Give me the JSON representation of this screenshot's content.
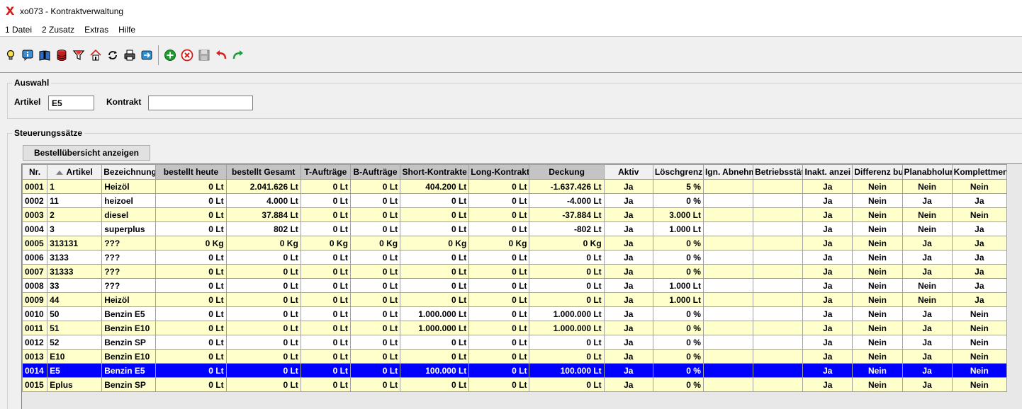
{
  "window": {
    "title": "xo073 - Kontraktverwaltung",
    "accent": "#d61a1a"
  },
  "menu": [
    "1 Datei",
    "2 Zusatz",
    "Extras",
    "Hilfe"
  ],
  "toolbar_icons": [
    "info-bulb-icon",
    "info-icon",
    "book-icon",
    "database-icon",
    "filter-icon",
    "home-icon",
    "refresh-icon",
    "print-icon",
    "mail-icon",
    "add-icon",
    "delete-icon",
    "save-icon",
    "undo-icon",
    "redo-icon"
  ],
  "auswahl": {
    "legend": "Auswahl",
    "artikel_label": "Artikel",
    "artikel_value": "E5",
    "kontrakt_label": "Kontrakt",
    "kontrakt_value": ""
  },
  "steuerung": {
    "legend": "Steuerungssätze",
    "button_label": "Bestellübersicht anzeigen"
  },
  "table": {
    "columns": [
      "Nr.",
      "Artikel",
      "Bezeichnung",
      "bestellt heute",
      "bestellt Gesamt",
      "T-Aufträge",
      "B-Aufträge",
      "Short-Kontrakte",
      "Long-Kontrakt",
      "Deckung",
      "Aktiv",
      "Löschgrenz",
      "Ign. Abnehm",
      "Betriebsstät",
      "Inakt. anzei",
      "Differenz bu",
      "Planabholur",
      "Komplettmen"
    ],
    "selected_color": "#0000ff",
    "rows": [
      [
        "0001",
        "1",
        "Heizöl",
        "0 Lt",
        "2.041.626 Lt",
        "0 Lt",
        "0 Lt",
        "404.200 Lt",
        "0 Lt",
        "-1.637.426 Lt",
        "Ja",
        "5 %",
        "",
        "",
        "Ja",
        "Nein",
        "Nein",
        "Nein"
      ],
      [
        "0002",
        "11",
        "heizoel",
        "0 Lt",
        "4.000 Lt",
        "0 Lt",
        "0 Lt",
        "0 Lt",
        "0 Lt",
        "-4.000 Lt",
        "Ja",
        "0 %",
        "",
        "",
        "Ja",
        "Nein",
        "Ja",
        "Ja"
      ],
      [
        "0003",
        "2",
        "diesel",
        "0 Lt",
        "37.884 Lt",
        "0 Lt",
        "0 Lt",
        "0 Lt",
        "0 Lt",
        "-37.884 Lt",
        "Ja",
        "3.000 Lt",
        "",
        "",
        "Ja",
        "Nein",
        "Nein",
        "Nein"
      ],
      [
        "0004",
        "3",
        "superplus",
        "0 Lt",
        "802 Lt",
        "0 Lt",
        "0 Lt",
        "0 Lt",
        "0 Lt",
        "-802 Lt",
        "Ja",
        "1.000 Lt",
        "",
        "",
        "Ja",
        "Nein",
        "Nein",
        "Ja"
      ],
      [
        "0005",
        "313131",
        "???",
        "0 Kg",
        "0 Kg",
        "0 Kg",
        "0 Kg",
        "0 Kg",
        "0 Kg",
        "0 Kg",
        "Ja",
        "0 %",
        "",
        "",
        "Ja",
        "Nein",
        "Ja",
        "Ja"
      ],
      [
        "0006",
        "3133",
        "???",
        "0 Lt",
        "0 Lt",
        "0 Lt",
        "0 Lt",
        "0 Lt",
        "0 Lt",
        "0 Lt",
        "Ja",
        "0 %",
        "",
        "",
        "Ja",
        "Nein",
        "Ja",
        "Ja"
      ],
      [
        "0007",
        "31333",
        "???",
        "0 Lt",
        "0 Lt",
        "0 Lt",
        "0 Lt",
        "0 Lt",
        "0 Lt",
        "0 Lt",
        "Ja",
        "0 %",
        "",
        "",
        "Ja",
        "Nein",
        "Ja",
        "Ja"
      ],
      [
        "0008",
        "33",
        "???",
        "0 Lt",
        "0 Lt",
        "0 Lt",
        "0 Lt",
        "0 Lt",
        "0 Lt",
        "0 Lt",
        "Ja",
        "1.000 Lt",
        "",
        "",
        "Ja",
        "Nein",
        "Nein",
        "Ja"
      ],
      [
        "0009",
        "44",
        "Heizöl",
        "0 Lt",
        "0 Lt",
        "0 Lt",
        "0 Lt",
        "0 Lt",
        "0 Lt",
        "0 Lt",
        "Ja",
        "1.000 Lt",
        "",
        "",
        "Ja",
        "Nein",
        "Nein",
        "Ja"
      ],
      [
        "0010",
        "50",
        "Benzin E5",
        "0 Lt",
        "0 Lt",
        "0 Lt",
        "0 Lt",
        "1.000.000 Lt",
        "0 Lt",
        "1.000.000 Lt",
        "Ja",
        "0 %",
        "",
        "",
        "Ja",
        "Nein",
        "Ja",
        "Nein"
      ],
      [
        "0011",
        "51",
        "Benzin E10",
        "0 Lt",
        "0 Lt",
        "0 Lt",
        "0 Lt",
        "1.000.000 Lt",
        "0 Lt",
        "1.000.000 Lt",
        "Ja",
        "0 %",
        "",
        "",
        "Ja",
        "Nein",
        "Ja",
        "Nein"
      ],
      [
        "0012",
        "52",
        "Benzin SP",
        "0 Lt",
        "0 Lt",
        "0 Lt",
        "0 Lt",
        "0 Lt",
        "0 Lt",
        "0 Lt",
        "Ja",
        "0 %",
        "",
        "",
        "Ja",
        "Nein",
        "Ja",
        "Nein"
      ],
      [
        "0013",
        "E10",
        "Benzin E10",
        "0 Lt",
        "0 Lt",
        "0 Lt",
        "0 Lt",
        "0 Lt",
        "0 Lt",
        "0 Lt",
        "Ja",
        "0 %",
        "",
        "",
        "Ja",
        "Nein",
        "Ja",
        "Nein"
      ],
      [
        "0014",
        "E5",
        "Benzin E5",
        "0 Lt",
        "0 Lt",
        "0 Lt",
        "0 Lt",
        "100.000 Lt",
        "0 Lt",
        "100.000 Lt",
        "Ja",
        "0 %",
        "",
        "",
        "Ja",
        "Nein",
        "Ja",
        "Nein"
      ],
      [
        "0015",
        "Eplus",
        "Benzin SP",
        "0 Lt",
        "0 Lt",
        "0 Lt",
        "0 Lt",
        "0 Lt",
        "0 Lt",
        "0 Lt",
        "Ja",
        "0 %",
        "",
        "",
        "Ja",
        "Nein",
        "Ja",
        "Nein"
      ]
    ],
    "selected_row": 13
  }
}
